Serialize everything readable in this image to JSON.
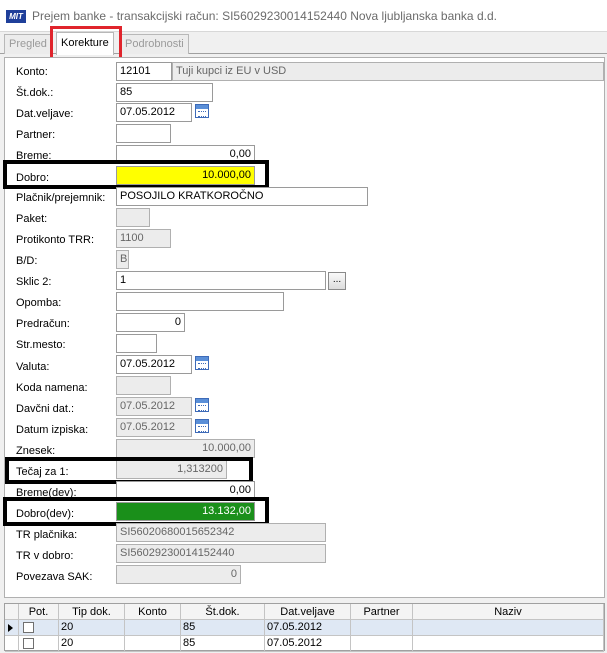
{
  "window": {
    "app_logo": "MIT",
    "title": "Prejem banke - transakcijski račun: SI56029230014152440  Nova ljubljanska banka d.d."
  },
  "tabs": [
    {
      "label": "Pregled",
      "active": false
    },
    {
      "label": "Korekture",
      "active": true
    },
    {
      "label": "Podrobnosti",
      "active": false
    }
  ],
  "form": {
    "konto": {
      "label": "Konto:",
      "value": "12101",
      "description": "Tuji kupci iz EU v USD"
    },
    "st_dok": {
      "label": "Št.dok.:",
      "value": "85"
    },
    "dat_veljave": {
      "label": "Dat.veljave:",
      "value": "07.05.2012"
    },
    "partner": {
      "label": "Partner:",
      "value": ""
    },
    "breme": {
      "label": "Breme:",
      "value": "0,00"
    },
    "dobro": {
      "label": "Dobro:",
      "value": "10.000,00"
    },
    "placnik": {
      "label": "Plačnik/prejemnik:",
      "value": "POSOJILO KRATKOROČNO"
    },
    "paket": {
      "label": "Paket:",
      "value": ""
    },
    "protikonto": {
      "label": "Protikonto TRR:",
      "value": "1100"
    },
    "bd": {
      "label": "B/D:",
      "value": "B"
    },
    "sklic2": {
      "label": "Sklic 2:",
      "value": "1",
      "button": "..."
    },
    "opomba": {
      "label": "Opomba:",
      "value": ""
    },
    "predracun": {
      "label": "Predračun:",
      "value": "0"
    },
    "str_mesto": {
      "label": "Str.mesto:",
      "value": ""
    },
    "valuta": {
      "label": "Valuta:",
      "value": "07.05.2012"
    },
    "koda_namena": {
      "label": "Koda namena:",
      "value": ""
    },
    "davcni_dat": {
      "label": "Davčni dat.:",
      "value": "07.05.2012"
    },
    "datum_izpiska": {
      "label": "Datum izpiska:",
      "value": "07.05.2012"
    },
    "znesek": {
      "label": "Znesek:",
      "value": "10.000,00"
    },
    "tecaj": {
      "label": "Tečaj za 1:",
      "value": "1,313200"
    },
    "breme_dev": {
      "label": "Breme(dev):",
      "value": "0,00"
    },
    "dobro_dev": {
      "label": "Dobro(dev):",
      "value": "13.132,00"
    },
    "tr_placnika": {
      "label": "TR plačnika:",
      "value": "SI56020680015652342"
    },
    "tr_v_dobro": {
      "label": "TR v dobro:",
      "value": "SI56029230014152440"
    },
    "povezava_sak": {
      "label": "Povezava SAK:",
      "value": "0"
    }
  },
  "grid": {
    "columns": [
      "Pot.",
      "Tip dok.",
      "Konto",
      "Št.dok.",
      "Dat.veljave",
      "Partner",
      "Naziv"
    ],
    "rows": [
      {
        "pot": "",
        "tip_dok": "20",
        "konto": "",
        "st_dok": "85",
        "dat_veljave": "07.05.2012",
        "partner": "",
        "naziv": ""
      },
      {
        "pot": "",
        "tip_dok": "20",
        "konto": "",
        "st_dok": "85",
        "dat_veljave": "07.05.2012",
        "partner": "",
        "naziv": ""
      }
    ]
  },
  "colors": {
    "highlight_yellow": "#ffff00",
    "highlight_green": "#1a8f1a",
    "annotation_red": "#e0242c",
    "annotation_black": "#000000"
  }
}
